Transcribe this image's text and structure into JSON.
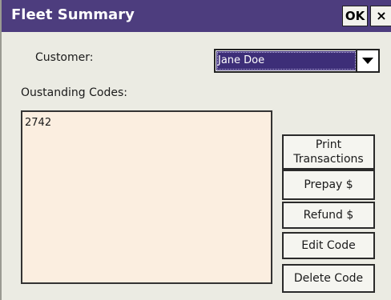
{
  "window": {
    "title": "Fleet Summary",
    "ok_label": "OK",
    "close_label": "×"
  },
  "customer": {
    "label": "Customer:",
    "selected": "Jane Doe"
  },
  "codes": {
    "label": "Oustanding Codes:",
    "items": [
      "2742"
    ]
  },
  "buttons": {
    "print_line1": "Print",
    "print_line2": "Transactions",
    "prepay": "Prepay $",
    "refund": "Refund $",
    "edit_code": "Edit Code",
    "delete_code": "Delete Code"
  },
  "colors": {
    "titlebar": "#4d3d7e",
    "selection": "#3d2e78",
    "list_bg": "#fbeee0",
    "window_bg": "#ebebe3"
  }
}
